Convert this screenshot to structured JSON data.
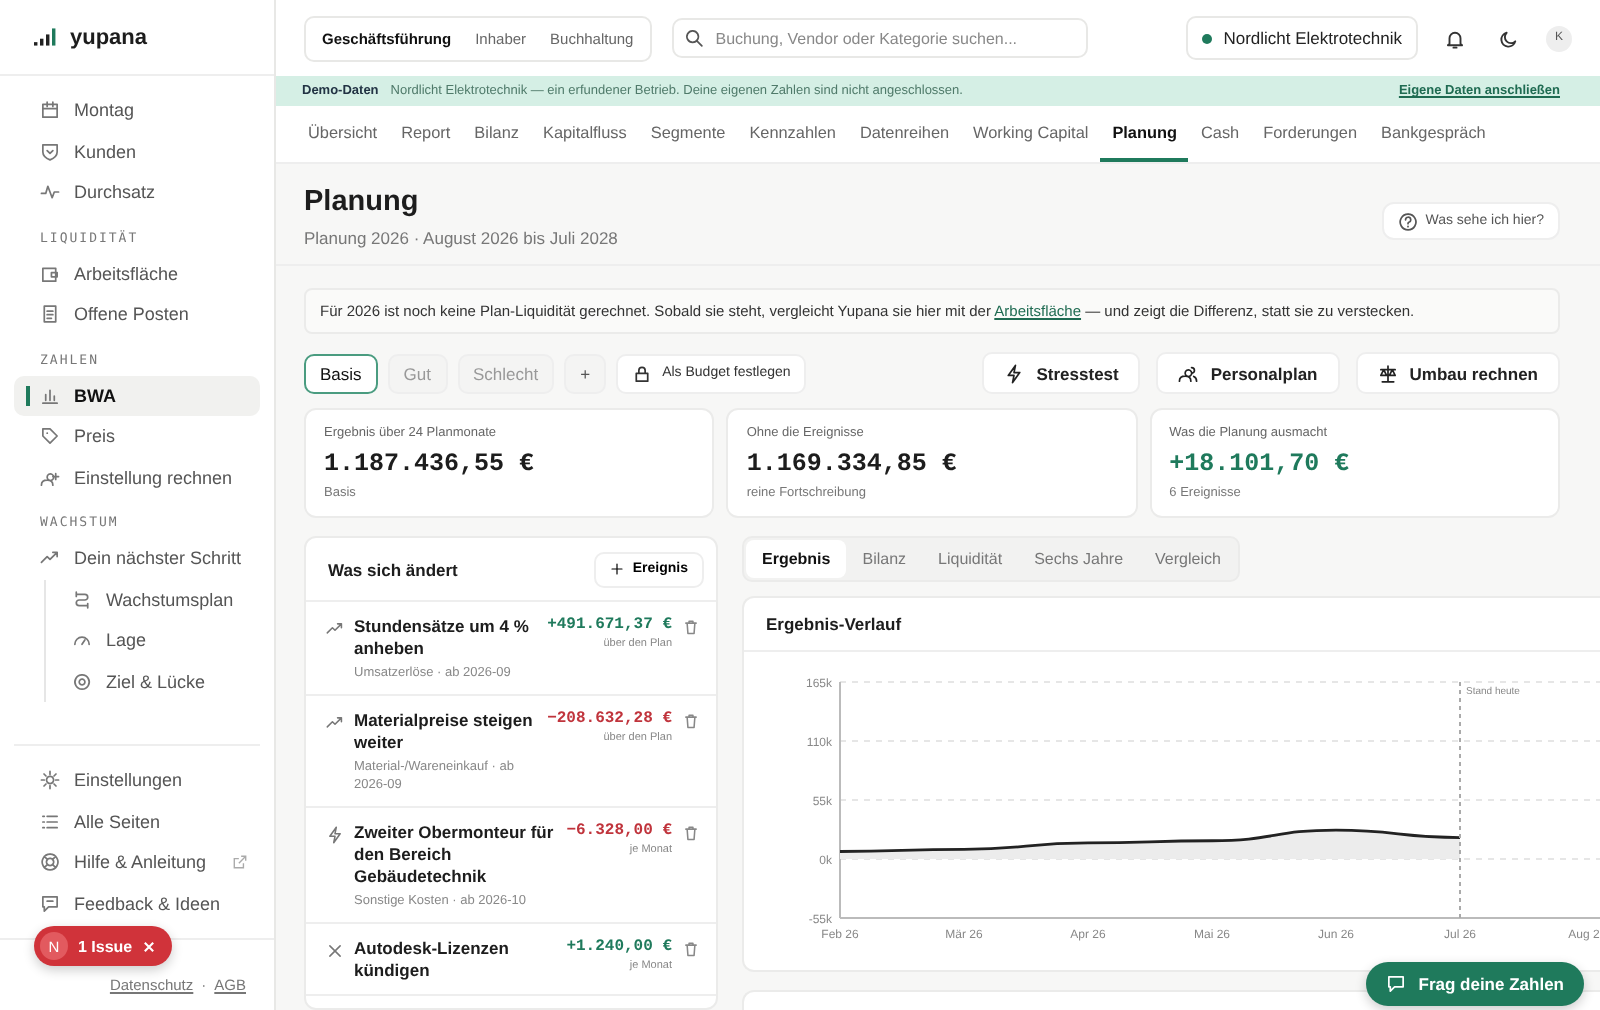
{
  "sidebar": {
    "brand": "yupana",
    "sections": [
      {
        "items": [
          {
            "label": "Montag",
            "selected": false
          },
          {
            "label": "Kunden",
            "selected": false
          },
          {
            "label": "Durchsatz",
            "selected": false
          }
        ]
      },
      {
        "label": "LIQUIDITÄT",
        "items": [
          {
            "label": "Arbeitsfläche",
            "selected": false
          },
          {
            "label": "Offene Posten",
            "selected": false
          }
        ]
      },
      {
        "label": "ZAHLEN",
        "items": [
          {
            "label": "BWA",
            "selected": true
          },
          {
            "label": "Preis",
            "selected": false
          },
          {
            "label": "Einstellung rechnen",
            "selected": false
          }
        ]
      },
      {
        "label": "WACHSTUM",
        "items": [
          {
            "label": "Dein nächster Schritt",
            "selected": false,
            "children": [
              {
                "label": "Wachstumsplan",
                "selected": false
              },
              {
                "label": "Lage",
                "selected": false
              },
              {
                "label": "Ziel & Lücke",
                "selected": false
              }
            ]
          }
        ]
      }
    ],
    "bottom_items": [
      {
        "label": "Einstellungen",
        "selected": false
      },
      {
        "label": "Alle Seiten",
        "selected": false
      },
      {
        "label": "Hilfe & Anleitung",
        "selected": false
      },
      {
        "label": "Feedback & Ideen",
        "selected": false
      }
    ],
    "footer_links": [
      "Datenschutz",
      "AGB"
    ],
    "footer_separator": "·",
    "issue_badge": {
      "avatar": "N",
      "label": "1 Issue"
    }
  },
  "topbar": {
    "roles": [
      {
        "label": "Geschäftsführung",
        "selected": true
      },
      {
        "label": "Inhaber",
        "selected": false
      },
      {
        "label": "Buchhaltung",
        "selected": false
      }
    ],
    "search": {
      "placeholder": "Buchung, Vendor oder Kategorie suchen..."
    },
    "company": "Nordlicht Elektrotechnik",
    "avatar": "K"
  },
  "banner": {
    "label": "Demo-Daten",
    "text": "Nordlicht Elektrotechnik — ein erfundener Betrieb. Deine eigenen Zahlen sind nicht angeschlossen.",
    "link": "Eigene Daten anschließen"
  },
  "nav_tabs": [
    {
      "label": "Übersicht",
      "selected": false
    },
    {
      "label": "Report",
      "selected": false
    },
    {
      "label": "Bilanz",
      "selected": false
    },
    {
      "label": "Kapitalfluss",
      "selected": false
    },
    {
      "label": "Segmente",
      "selected": false
    },
    {
      "label": "Kennzahlen",
      "selected": false
    },
    {
      "label": "Datenreihen",
      "selected": false
    },
    {
      "label": "Working Capital",
      "selected": false
    },
    {
      "label": "Planung",
      "selected": true
    },
    {
      "label": "Cash",
      "selected": false
    },
    {
      "label": "Forderungen",
      "selected": false
    },
    {
      "label": "Bankgespräch",
      "selected": false
    }
  ],
  "header": {
    "title": "Planung",
    "subtitle": "Planung 2026 · August 2026 bis Juli 2028",
    "help_button": "Was sehe ich hier?"
  },
  "note": {
    "before": "Für 2026 ist noch keine Plan-Liquidität gerechnet. Sobald sie steht, vergleicht Yupana sie hier mit der ",
    "link": "Arbeitsfläche",
    "after": " — und zeigt die Differenz, statt sie zu verstecken."
  },
  "scenarios": [
    {
      "label": "Basis",
      "selected": true
    },
    {
      "label": "Gut",
      "selected": false
    },
    {
      "label": "Schlecht",
      "selected": false
    }
  ],
  "add_scenario": "+",
  "budget_button": "Als Budget festlegen",
  "actions": [
    "Stresstest",
    "Personalplan",
    "Umbau rechnen"
  ],
  "kpis": [
    {
      "label": "Ergebnis über 24 Planmonate",
      "value": "1.187.436,55 €",
      "note": "Basis",
      "positive": false
    },
    {
      "label": "Ohne die Ereignisse",
      "value": "1.169.334,85 €",
      "note": "reine Fortschreibung",
      "positive": false
    },
    {
      "label": "Was die Planung ausmacht",
      "value": "+18.101,70 €",
      "note": "6 Ereignisse",
      "positive": true
    }
  ],
  "events": {
    "title": "Was sich ändert",
    "add_button": "Ereignis",
    "items": [
      {
        "kind": "trend",
        "title": "Stundensätze um 4 % anheben",
        "meta": "Umsatzerlöse · ab 2026-09",
        "amount": "+491.671,37 €",
        "negative": false,
        "unit": "über den Plan"
      },
      {
        "kind": "trend",
        "title": "Materialpreise steigen weiter",
        "meta": "Material-/Wareneinkauf · ab 2026-09",
        "amount": "−208.632,28 €",
        "negative": true,
        "unit": "über den Plan"
      },
      {
        "kind": "bolt",
        "title": "Zweiter Obermonteur für den Bereich Gebäudetechnik",
        "meta": "Sonstige Kosten · ab 2026-10",
        "amount": "−6.328,00 €",
        "negative": true,
        "unit": "je Monat"
      },
      {
        "kind": "cancel",
        "title": "Autodesk-Lizenzen kündigen",
        "amount": "+1.240,00 €",
        "negative": false,
        "unit": "je Monat"
      }
    ]
  },
  "chart_panel": {
    "tabs": [
      {
        "label": "Ergebnis",
        "selected": true
      },
      {
        "label": "Bilanz",
        "selected": false
      },
      {
        "label": "Liquidität",
        "selected": false
      },
      {
        "label": "Sechs Jahre",
        "selected": false
      },
      {
        "label": "Vergleich",
        "selected": false
      }
    ],
    "chart_data": {
      "type": "area",
      "grid": true,
      "title": "Ergebnis-Verlauf",
      "categories": [
        "Feb 26",
        "Mär 26",
        "Apr 26",
        "Mai 26",
        "Jun 26",
        "Jul 26",
        "Aug 2"
      ],
      "series": [
        {
          "color": "#222222",
          "values": [
            7000,
            9000,
            15000,
            17000,
            27000,
            20000,
            null
          ]
        }
      ],
      "ylim": [
        -55000,
        165000
      ],
      "yticks": [
        {
          "value": -55000,
          "label": "-55k"
        },
        {
          "value": 0,
          "label": "0k"
        },
        {
          "value": 55000,
          "label": "55k"
        },
        {
          "value": 110000,
          "label": "110k"
        },
        {
          "value": 165000,
          "label": "165k"
        }
      ],
      "ref_lines": [
        {
          "axis": "x",
          "value": "Jul 26",
          "label": "Stand heute"
        }
      ]
    }
  },
  "ask_button": "Frag deine Zahlen"
}
